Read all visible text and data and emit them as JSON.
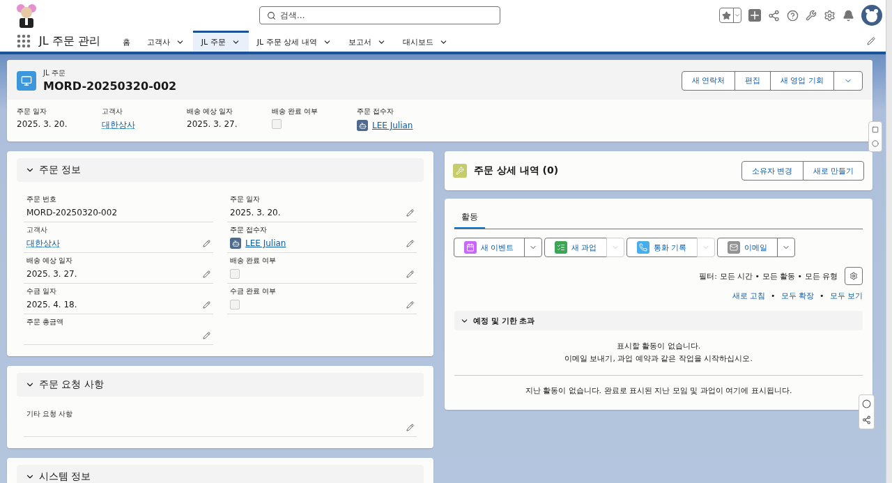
{
  "header": {
    "search": {
      "placeholder": "검색..."
    }
  },
  "nav": {
    "app_name": "JL 주문 관리",
    "tabs": [
      {
        "label": "홈",
        "selected": false,
        "has_menu": false
      },
      {
        "label": "고객사",
        "selected": false,
        "has_menu": true
      },
      {
        "label": "JL 주문",
        "selected": true,
        "has_menu": true
      },
      {
        "label": "JL 주문 상세 내역",
        "selected": false,
        "has_menu": true
      },
      {
        "label": "보고서",
        "selected": false,
        "has_menu": true
      },
      {
        "label": "대시보드",
        "selected": false,
        "has_menu": true
      }
    ]
  },
  "record": {
    "object_type": "JL 주문",
    "title": "MORD-20250320-002",
    "actions": [
      "새 연락처",
      "편집",
      "새 영업 기회"
    ],
    "highlights": [
      {
        "label": "주문 일자",
        "kind": "text",
        "value": "2025. 3. 20."
      },
      {
        "label": "고객사",
        "kind": "link",
        "value": "대한상사"
      },
      {
        "label": "배송 예상 일자",
        "kind": "text",
        "value": "2025. 3. 27."
      },
      {
        "label": "배송 완료 여부",
        "kind": "checkbox",
        "checked": false
      },
      {
        "label": "주문 접수자",
        "kind": "user",
        "value": "LEE Julian"
      }
    ]
  },
  "sections": [
    {
      "title": "주문 정보",
      "expanded": true,
      "columns": [
        [
          {
            "label": "주문 번호",
            "kind": "text",
            "value": "MORD-20250320-002",
            "editable": false
          },
          {
            "label": "고객사",
            "kind": "link",
            "value": "대한상사",
            "editable": true
          },
          {
            "label": "배송 예상 일자",
            "kind": "text",
            "value": "2025. 3. 27.",
            "editable": true
          },
          {
            "label": "수금 일자",
            "kind": "text",
            "value": "2025. 4. 18.",
            "editable": true
          },
          {
            "label": "주문 총금액",
            "kind": "text",
            "editable": true
          }
        ],
        [
          {
            "label": "주문 일자",
            "kind": "text",
            "value": "2025. 3. 20.",
            "editable": true
          },
          {
            "label": "주문 접수자",
            "kind": "user",
            "value": "LEE Julian",
            "editable": true
          },
          {
            "label": "배송 완료 여부",
            "kind": "checkbox",
            "checked": false,
            "editable": true
          },
          {
            "label": "수금 완료 여부",
            "kind": "checkbox",
            "checked": false,
            "editable": true
          }
        ]
      ]
    },
    {
      "title": "주문 요청 사항",
      "expanded": true,
      "columns": [
        [
          {
            "label": "기타 요청 사항",
            "kind": "text",
            "editable": true
          }
        ]
      ]
    },
    {
      "title": "시스템 정보",
      "expanded": true
    }
  ],
  "related": {
    "title": "주문 상세 내역 (0)",
    "actions": [
      "소유자 변경",
      "새로 만들기"
    ]
  },
  "activity": {
    "tabs": [
      {
        "label": "활동",
        "selected": true
      }
    ],
    "actions": [
      {
        "label": "새 이벤트",
        "kind": "event",
        "menu_disabled": false
      },
      {
        "label": "새 과업",
        "kind": "task",
        "menu_disabled": true
      },
      {
        "label": "통화 기록",
        "kind": "call",
        "menu_disabled": true
      },
      {
        "label": "이메일",
        "kind": "email",
        "menu_disabled": false
      }
    ],
    "filter": "필터: 모든 시간 • 모든 활동 • 모든 유형",
    "links": [
      "새로 고침",
      "모두 확장",
      "모두 보기"
    ],
    "link_separator": "•",
    "upcoming": {
      "title": "예정 및 기한 초과",
      "expanded": true,
      "empty_lines": [
        "표시할 활동이 없습니다.",
        "이메일 보내기, 과업 예약과 같은 작업을 시작하십시오."
      ]
    },
    "past_message": "지난 활동이 없습니다. 완료로 표시된 지난 모임 및 과업이 여기에 표시됩니다."
  }
}
